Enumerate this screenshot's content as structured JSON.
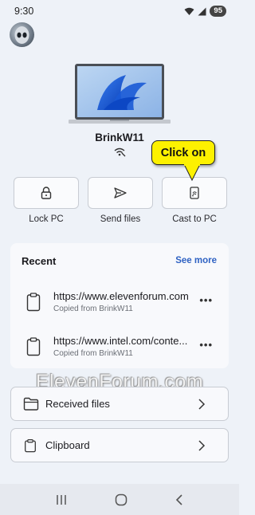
{
  "status_bar": {
    "time": "9:30",
    "battery": "95"
  },
  "device": {
    "name": "BrinkW11"
  },
  "callout": {
    "text": "Click on"
  },
  "actions": [
    {
      "label": "Lock PC",
      "icon": "lock-icon"
    },
    {
      "label": "Send files",
      "icon": "send-icon"
    },
    {
      "label": "Cast to PC",
      "icon": "cast-icon"
    }
  ],
  "recent": {
    "title": "Recent",
    "see_more": "See more",
    "items": [
      {
        "url": "https://www.elevenforum.com",
        "source": "Copied from BrinkW11"
      },
      {
        "url": "https://www.intel.com/content",
        "source": "Copied from BrinkW11"
      }
    ]
  },
  "watermark": "ElevenForum.com",
  "rows": [
    {
      "label": "Received files",
      "icon": "folder-icon"
    },
    {
      "label": "Clipboard",
      "icon": "clipboard-icon"
    }
  ],
  "colors": {
    "accent": "#2f62c3",
    "callout": "#fdf100",
    "background": "#eef2f8"
  }
}
